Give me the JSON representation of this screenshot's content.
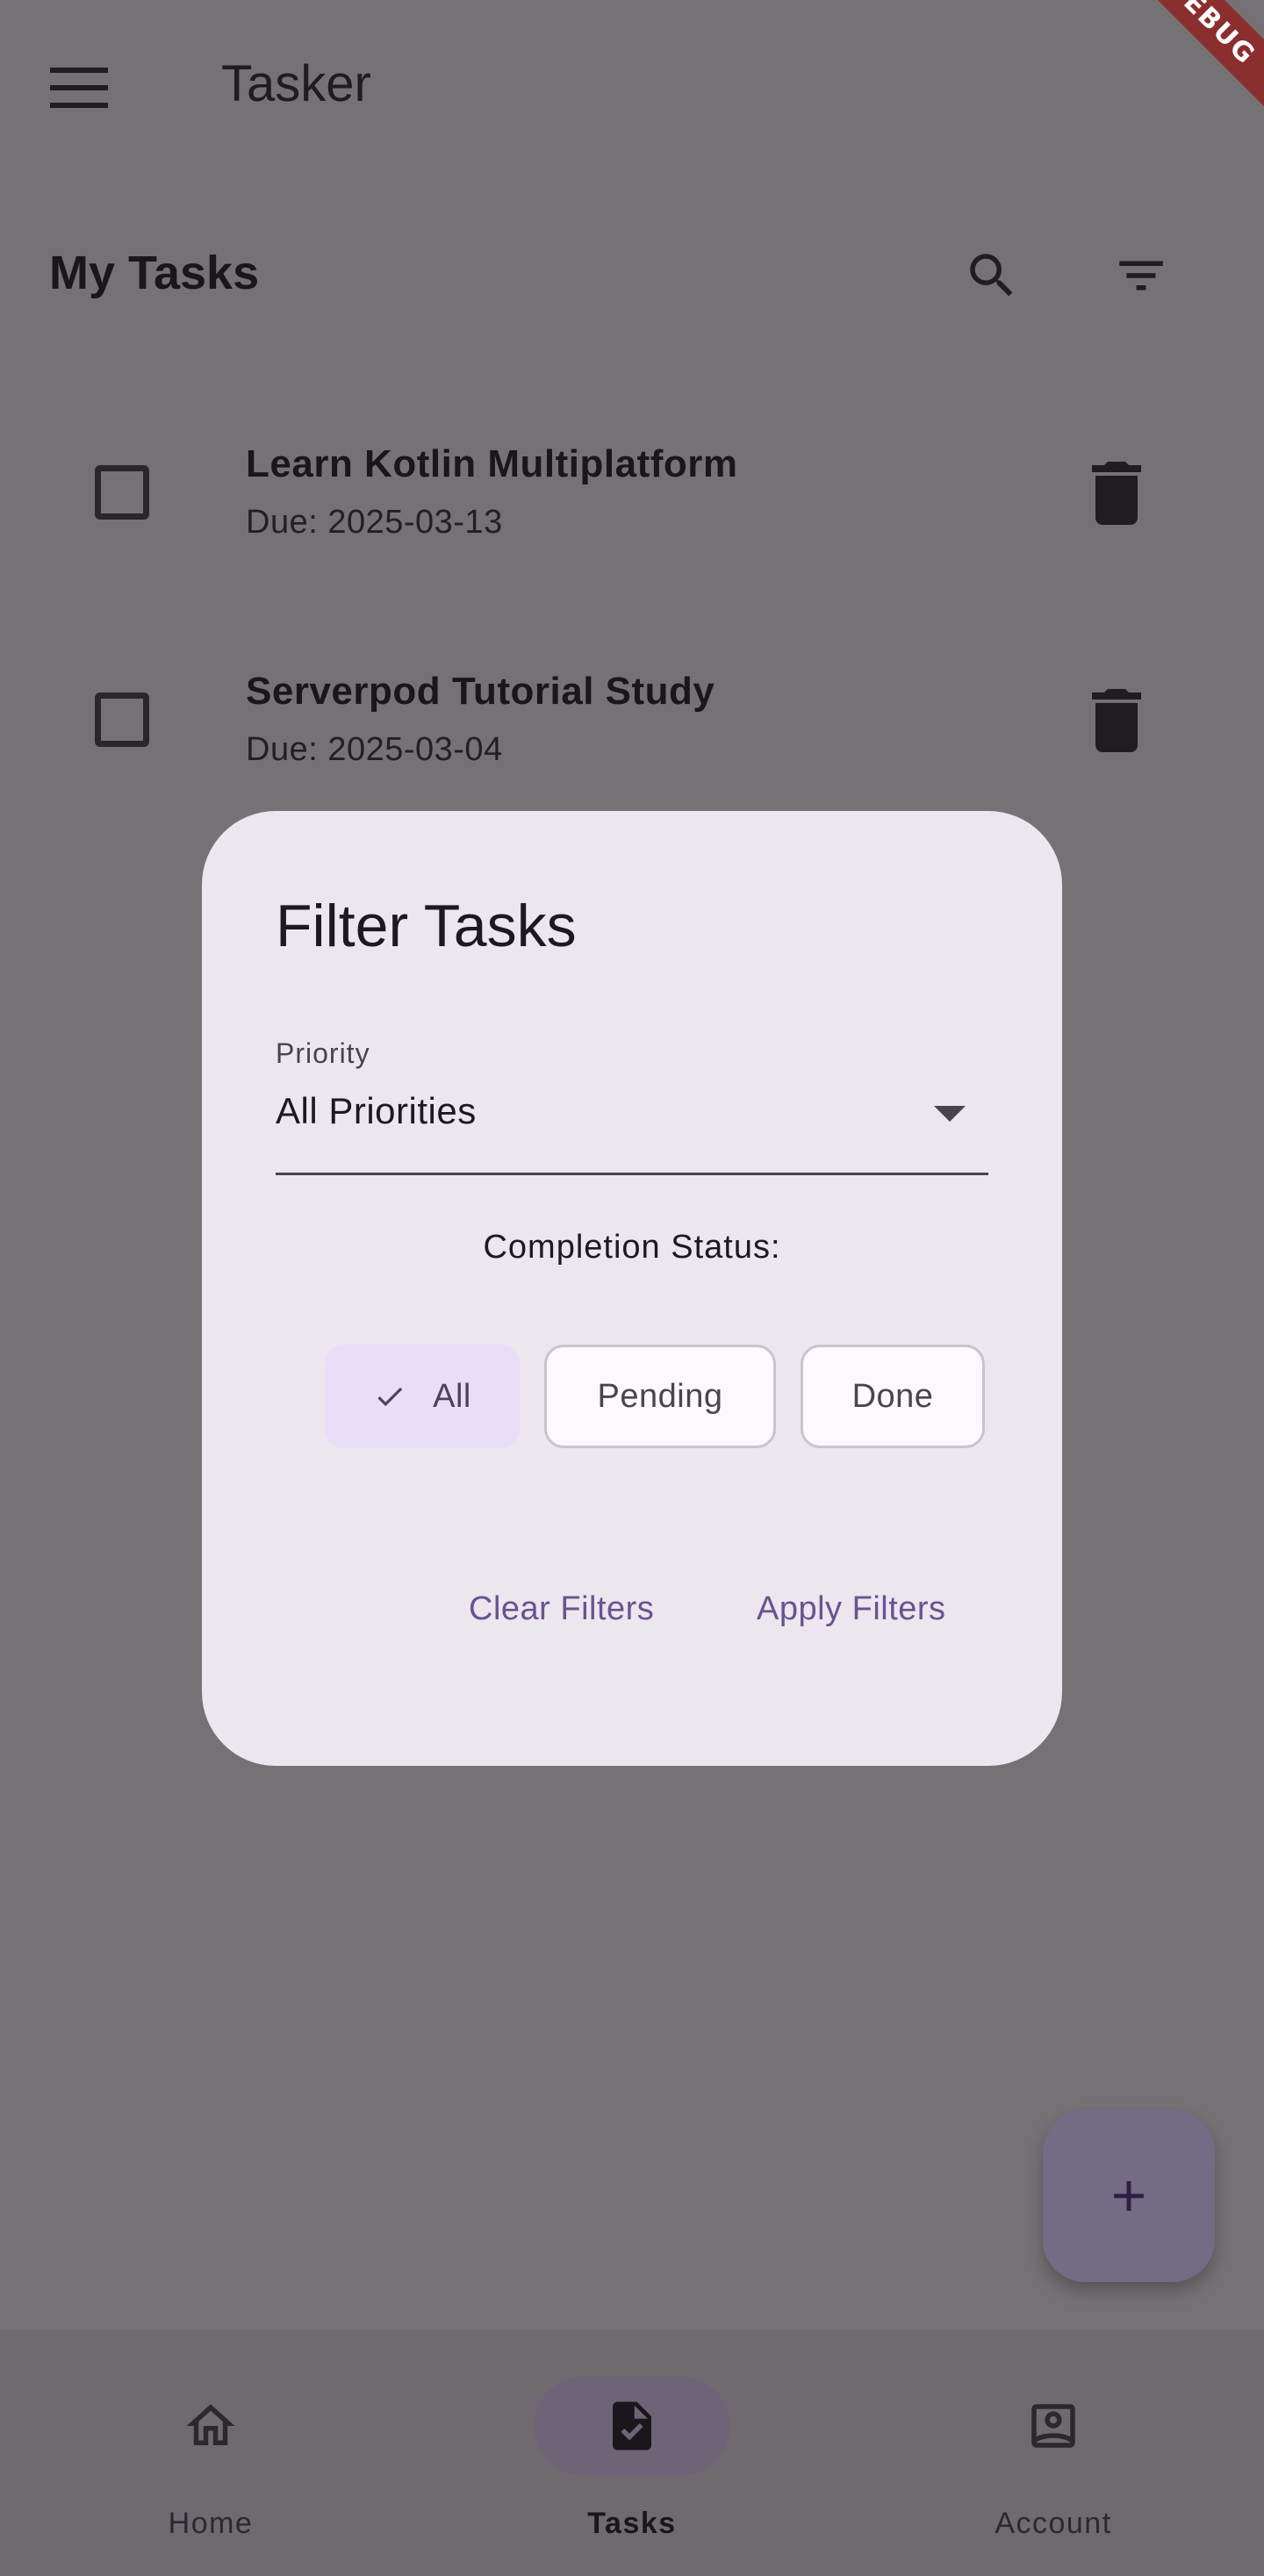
{
  "appbar": {
    "title": "Tasker",
    "debug_banner": "DEBUG"
  },
  "page": {
    "section_title": "My Tasks"
  },
  "tasks": [
    {
      "name": "Learn Kotlin Multiplatform",
      "due": "Due: 2025-03-13"
    },
    {
      "name": "Serverpod Tutorial Study",
      "due": "Due: 2025-03-04"
    }
  ],
  "dialog": {
    "title": "Filter Tasks",
    "priority_label": "Priority",
    "priority_value": "All Priorities",
    "status_label": "Completion Status:",
    "chips": [
      {
        "label": "All",
        "selected": true
      },
      {
        "label": "Pending",
        "selected": false
      },
      {
        "label": "Done",
        "selected": false
      }
    ],
    "clear_label": "Clear Filters",
    "apply_label": "Apply Filters"
  },
  "bottom_nav": {
    "items": [
      {
        "label": "Home",
        "icon": "home-icon",
        "active": false
      },
      {
        "label": "Tasks",
        "icon": "task-icon",
        "active": true
      },
      {
        "label": "Account",
        "icon": "account-icon",
        "active": false
      }
    ]
  },
  "colors": {
    "scrim": "#757175",
    "dialog_bg": "#ece6ef",
    "accent": "#65558f",
    "chip_selected": "#e8def8"
  }
}
